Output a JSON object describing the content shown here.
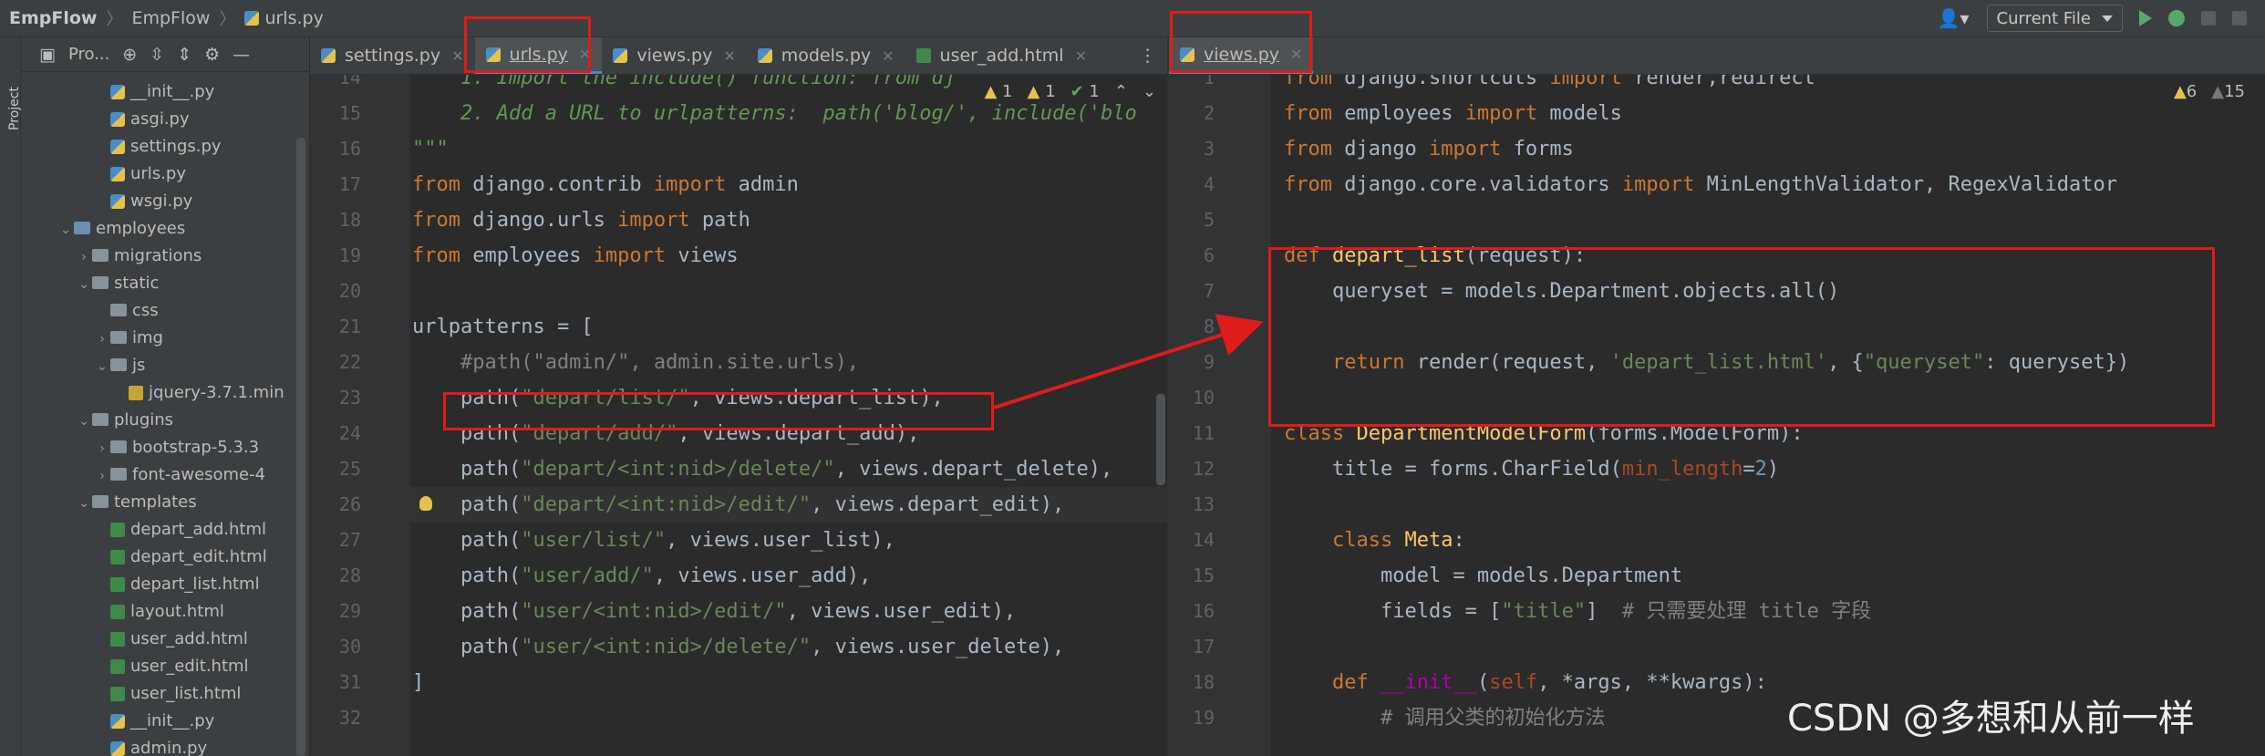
{
  "breadcrumb": [
    "EmpFlow",
    "EmpFlow",
    "urls.py"
  ],
  "run_config": {
    "label": "Current File"
  },
  "project_panel": {
    "title": "Pro...",
    "stripe_label": "Project",
    "tree": [
      {
        "label": "__init__.py",
        "type": "py"
      },
      {
        "label": "asgi.py",
        "type": "py"
      },
      {
        "label": "settings.py",
        "type": "py"
      },
      {
        "label": "urls.py",
        "type": "py"
      },
      {
        "label": "wsgi.py",
        "type": "py"
      },
      {
        "label": "employees",
        "type": "folder-blue",
        "expanded": true
      },
      {
        "label": "migrations",
        "type": "folder",
        "expanded": false
      },
      {
        "label": "static",
        "type": "folder",
        "expanded": true
      },
      {
        "label": "css",
        "type": "folder"
      },
      {
        "label": "img",
        "type": "folder",
        "expanded": false
      },
      {
        "label": "js",
        "type": "folder",
        "expanded": true
      },
      {
        "label": "jquery-3.7.1.min",
        "type": "js"
      },
      {
        "label": "plugins",
        "type": "folder",
        "expanded": true
      },
      {
        "label": "bootstrap-5.3.3",
        "type": "folder",
        "expanded": false
      },
      {
        "label": "font-awesome-4",
        "type": "folder",
        "expanded": false
      },
      {
        "label": "templates",
        "type": "folder",
        "expanded": true
      },
      {
        "label": "depart_add.html",
        "type": "html"
      },
      {
        "label": "depart_edit.html",
        "type": "html"
      },
      {
        "label": "depart_list.html",
        "type": "html"
      },
      {
        "label": "layout.html",
        "type": "html"
      },
      {
        "label": "user_add.html",
        "type": "html"
      },
      {
        "label": "user_edit.html",
        "type": "html"
      },
      {
        "label": "user_list.html",
        "type": "html"
      },
      {
        "label": "__init__.py",
        "type": "py"
      },
      {
        "label": "admin.py",
        "type": "py"
      }
    ]
  },
  "left_editor": {
    "tabs": [
      "settings.py",
      "urls.py",
      "views.py",
      "models.py",
      "user_add.html"
    ],
    "active_tab": "urls.py",
    "inspections": {
      "warnings": "1",
      "weak": "1",
      "ok": "1"
    },
    "line_numbers": [
      "14",
      "15",
      "16",
      "17",
      "18",
      "19",
      "20",
      "21",
      "22",
      "23",
      "24",
      "25",
      "26",
      "27",
      "28",
      "29",
      "30",
      "31",
      "32"
    ],
    "lines": [
      "    1. Import the include() function: from dj",
      "    2. Add a URL to urlpatterns:  path('blog/', include('blo",
      "\"\"\"",
      "from django.contrib import admin",
      "from django.urls import path",
      "from employees import views",
      "",
      "urlpatterns = [",
      "    #path(\"admin/\", admin.site.urls),",
      "    path(\"depart/list/\", views.depart_list),",
      "    path(\"depart/add/\", views.depart_add),",
      "    path(\"depart/<int:nid>/delete/\", views.depart_delete),",
      "    path(\"depart/<int:nid>/edit/\", views.depart_edit),",
      "    path(\"user/list/\", views.user_list),",
      "    path(\"user/add/\", views.user_add),",
      "    path(\"user/<int:nid>/edit/\", views.user_edit),",
      "    path(\"user/<int:nid>/delete/\", views.user_delete),",
      "]",
      ""
    ]
  },
  "right_editor": {
    "tabs": [
      "views.py"
    ],
    "active_tab": "views.py",
    "inspections": {
      "warnings": "6",
      "weak": "15"
    },
    "line_numbers": [
      "1",
      "2",
      "3",
      "4",
      "5",
      "6",
      "7",
      "8",
      "9",
      "10",
      "11",
      "12",
      "13",
      "14",
      "15",
      "16",
      "17",
      "18",
      "19"
    ],
    "lines": [
      "from django.shortcuts import render,redirect",
      "from employees import models",
      "from django import forms",
      "from django.core.validators import MinLengthValidator, RegexValidator",
      "",
      "def depart_list(request):",
      "    queryset = models.Department.objects.all()",
      "",
      "    return render(request, 'depart_list.html', {\"queryset\": queryset})",
      "",
      "class DepartmentModelForm(forms.ModelForm):",
      "    title = forms.CharField(min_length=2)",
      "",
      "    class Meta:",
      "        model = models.Department",
      "        fields = [\"title\"]  # 只需要处理 title 字段",
      "",
      "    def __init__(self, *args, **kwargs):",
      "        # 调用父类的初始化方法"
    ]
  },
  "watermark": "CSDN @多想和从前一样",
  "colors": {
    "annotation": "#e01b1b",
    "keyword": "#cc7832",
    "string": "#6a8759",
    "background": "#2b2b2b"
  }
}
